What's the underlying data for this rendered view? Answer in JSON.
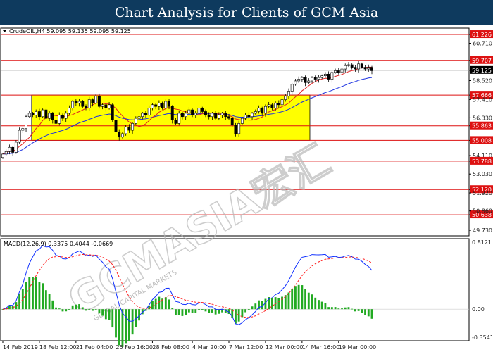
{
  "banner": {
    "title": "Chart Analysis for Clients of GCM Asia"
  },
  "watermark": {
    "text": "GCMASIA宏汇",
    "subtext": "GLOBAL CAPITAL MARKETS"
  },
  "chart_data": [
    {
      "type": "candlestick",
      "symbol_label": "CrudeOIL,H4",
      "ohlc_label": "59.095 59.135 59.095 59.125",
      "current_price": 59.125,
      "current_price_label": "59.125",
      "ylim": [
        49.4,
        61.6
      ],
      "y_ticks": [
        "61.226",
        "60.710",
        "59.707",
        "59.125",
        "58.520",
        "57.666",
        "57.410",
        "56.330",
        "55.863",
        "55.008",
        "54.110",
        "53.788",
        "53.030",
        "52.120",
        "51.920",
        "50.638",
        "50.860",
        "49.730"
      ],
      "levels": [
        {
          "value": 61.226,
          "label": "61.226"
        },
        {
          "value": 59.707,
          "label": "59.707"
        },
        {
          "value": 57.666,
          "label": "57.666"
        },
        {
          "value": 55.863,
          "label": "55.863"
        },
        {
          "value": 55.008,
          "label": "55.008"
        },
        {
          "value": 53.788,
          "label": "53.788"
        },
        {
          "value": 52.12,
          "label": "52.120"
        },
        {
          "value": 50.638,
          "label": "50.638"
        }
      ],
      "zone": {
        "from_bar": 4,
        "to_bar": 86,
        "low": 55.008,
        "high": 57.666,
        "color": "#ffff00"
      },
      "x_labels": [
        {
          "bar": 0,
          "label": "14 Feb 2019"
        },
        {
          "bar": 11,
          "label": "18 Feb 12:00"
        },
        {
          "bar": 22,
          "label": "21 Feb 04:00"
        },
        {
          "bar": 34,
          "label": "25 Feb 16:00"
        },
        {
          "bar": 45,
          "label": "28 Feb 08:00"
        },
        {
          "bar": 57,
          "label": "4 Mar 20:00"
        },
        {
          "bar": 68,
          "label": "7 Mar 12:00"
        },
        {
          "bar": 79,
          "label": "12 Mar 00:00"
        },
        {
          "bar": 90,
          "label": "14 Mar 16:00"
        },
        {
          "bar": 101,
          "label": "19 Mar 00:00"
        }
      ],
      "closes": [
        54.2,
        54.35,
        54.6,
        54.3,
        54.9,
        55.6,
        55.7,
        56.4,
        56.6,
        56.5,
        56.7,
        56.4,
        56.8,
        56.3,
        56.6,
        56.2,
        56.0,
        56.5,
        56.3,
        56.6,
        56.9,
        57.3,
        57.2,
        57.3,
        57.0,
        56.9,
        57.4,
        57.2,
        57.6,
        57.0,
        57.1,
        56.9,
        57.1,
        56.2,
        55.5,
        55.2,
        55.4,
        55.8,
        55.6,
        56.0,
        56.3,
        56.4,
        56.6,
        56.5,
        56.9,
        57.1,
        57.0,
        57.2,
        56.9,
        57.3,
        57.0,
        56.2,
        56.0,
        56.6,
        56.4,
        56.6,
        56.8,
        56.5,
        56.6,
        56.9,
        56.7,
        56.5,
        56.4,
        56.6,
        56.3,
        56.5,
        56.6,
        56.4,
        56.3,
        55.9,
        55.4,
        56.0,
        56.3,
        56.5,
        56.4,
        56.6,
        56.7,
        56.9,
        56.6,
        57.0,
        57.1,
        56.9,
        57.2,
        57.1,
        57.4,
        57.6,
        57.9,
        58.3,
        58.5,
        58.6,
        58.7,
        58.4,
        58.5,
        58.7,
        58.6,
        58.7,
        58.8,
        58.9,
        58.6,
        59.0,
        59.1,
        59.0,
        59.2,
        59.4,
        59.45,
        59.3,
        59.2,
        59.5,
        59.3,
        59.2,
        59.3,
        59.1
      ],
      "indicator": {
        "name": "MACD(12,26,9)",
        "values_label": "0.3375 0.4044 -0.0669",
        "ylim": [
          -0.3541,
          0.8121
        ],
        "y_ticks": [
          "0.8121",
          "0.00",
          "-0.3541"
        ],
        "series": [
          {
            "name": "MACD",
            "color": "#1030ff",
            "style": "solid"
          },
          {
            "name": "Signal",
            "color": "#ff2020",
            "style": "dashed"
          }
        ],
        "histogram_color": "#22aa22"
      }
    }
  ]
}
